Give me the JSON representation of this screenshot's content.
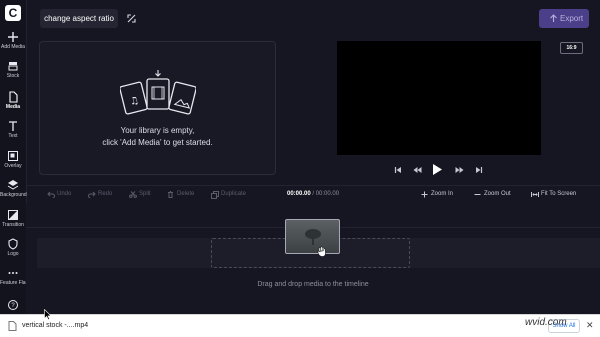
{
  "app": {
    "logo_letter": "C"
  },
  "sidebar": {
    "items": [
      {
        "label": "Add Media",
        "icon": "plus-icon"
      },
      {
        "label": "Stock",
        "icon": "stock-icon"
      },
      {
        "label": "Media",
        "icon": "media-file-icon",
        "active": true
      },
      {
        "label": "Text",
        "icon": "text-icon"
      },
      {
        "label": "Overlay",
        "icon": "overlay-icon"
      },
      {
        "label": "Background",
        "icon": "background-layers-icon"
      },
      {
        "label": "Transition",
        "icon": "transition-icon"
      },
      {
        "label": "Logo",
        "icon": "logo-shield-icon"
      },
      {
        "label": "Feature Flags",
        "icon": "more-dots-icon"
      }
    ],
    "help_icon": "help-icon"
  },
  "header": {
    "project_title": "change aspect ratio",
    "export_label": "Export"
  },
  "library": {
    "empty_line1": "Your library is empty,",
    "empty_line2": "click 'Add Media' to get started."
  },
  "preview": {
    "aspect_ratio": "16:9",
    "controls": [
      "skip-back-icon",
      "rewind-icon",
      "play-icon",
      "fast-forward-icon",
      "skip-forward-icon"
    ]
  },
  "toolbar": {
    "undo": "Undo",
    "redo": "Redo",
    "split": "Split",
    "delete": "Delete",
    "duplicate": "Duplicate",
    "time_current": "00:00.00",
    "time_separator": "/",
    "time_total": "00:00.00",
    "zoom_in": "Zoom In",
    "zoom_out": "Zoom Out",
    "fit_to_screen": "Fit To Screen"
  },
  "timeline": {
    "drag_hint": "Drag and drop media to the timeline"
  },
  "downloads": {
    "file_name": "vertical stock -....mp4",
    "show_all": "Show All"
  },
  "watermark": "wvid.com",
  "colors": {
    "background": "#161622",
    "export_button": "#4c3f8a",
    "preview": "#000000",
    "download_bar": "#ffffff"
  }
}
